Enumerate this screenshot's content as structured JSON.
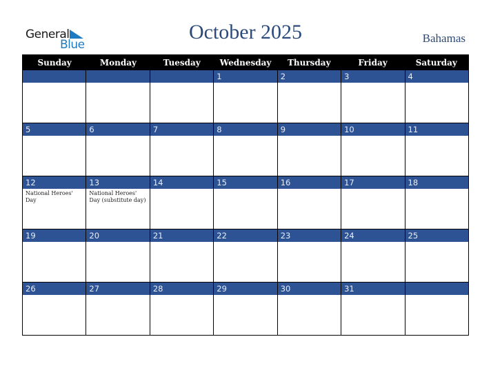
{
  "logo": {
    "line1": "General",
    "line2": "Blue"
  },
  "header": {
    "title": "October 2025",
    "country": "Bahamas"
  },
  "colors": {
    "band": "#2e5395",
    "title": "#2b4a7a",
    "logo_blue": "#1f7bc1"
  },
  "weekdays": [
    "Sunday",
    "Monday",
    "Tuesday",
    "Wednesday",
    "Thursday",
    "Friday",
    "Saturday"
  ],
  "weeks": [
    [
      {
        "day": "",
        "event": ""
      },
      {
        "day": "",
        "event": ""
      },
      {
        "day": "",
        "event": ""
      },
      {
        "day": "1",
        "event": ""
      },
      {
        "day": "2",
        "event": ""
      },
      {
        "day": "3",
        "event": ""
      },
      {
        "day": "4",
        "event": ""
      }
    ],
    [
      {
        "day": "5",
        "event": ""
      },
      {
        "day": "6",
        "event": ""
      },
      {
        "day": "7",
        "event": ""
      },
      {
        "day": "8",
        "event": ""
      },
      {
        "day": "9",
        "event": ""
      },
      {
        "day": "10",
        "event": ""
      },
      {
        "day": "11",
        "event": ""
      }
    ],
    [
      {
        "day": "12",
        "event": "National Heroes' Day"
      },
      {
        "day": "13",
        "event": "National Heroes' Day (substitute day)"
      },
      {
        "day": "14",
        "event": ""
      },
      {
        "day": "15",
        "event": ""
      },
      {
        "day": "16",
        "event": ""
      },
      {
        "day": "17",
        "event": ""
      },
      {
        "day": "18",
        "event": ""
      }
    ],
    [
      {
        "day": "19",
        "event": ""
      },
      {
        "day": "20",
        "event": ""
      },
      {
        "day": "21",
        "event": ""
      },
      {
        "day": "22",
        "event": ""
      },
      {
        "day": "23",
        "event": ""
      },
      {
        "day": "24",
        "event": ""
      },
      {
        "day": "25",
        "event": ""
      }
    ],
    [
      {
        "day": "26",
        "event": ""
      },
      {
        "day": "27",
        "event": ""
      },
      {
        "day": "28",
        "event": ""
      },
      {
        "day": "29",
        "event": ""
      },
      {
        "day": "30",
        "event": ""
      },
      {
        "day": "31",
        "event": ""
      },
      {
        "day": "",
        "event": ""
      }
    ]
  ]
}
